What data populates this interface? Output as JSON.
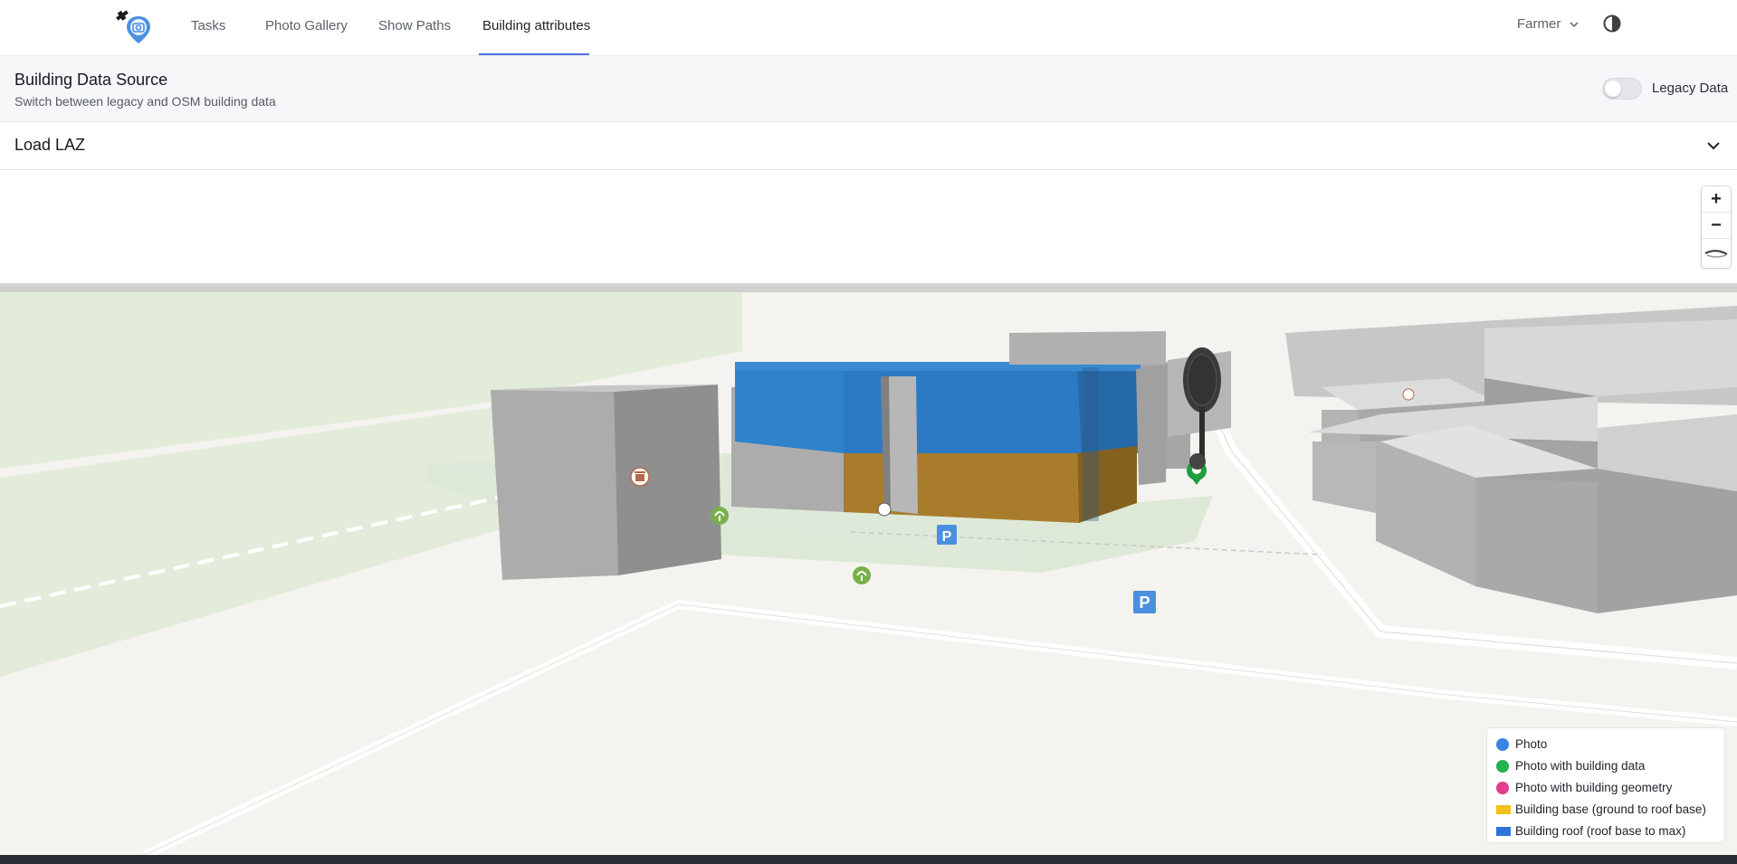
{
  "nav": {
    "tabs": [
      {
        "label": "Tasks"
      },
      {
        "label": "Photo Gallery"
      },
      {
        "label": "Show Paths"
      },
      {
        "label": "Building attributes",
        "active": true
      }
    ],
    "user": "Farmer",
    "accent": "#4a6fd6",
    "logo_icon": "camera-pin-satellite-icon",
    "theme_icon": "contrast-icon"
  },
  "source": {
    "title": "Building Data Source",
    "subtitle": "Switch between legacy and OSM building data",
    "toggle_label": "Legacy Data",
    "toggle_on": false
  },
  "laz": {
    "title": "Load LAZ",
    "expanded": false
  },
  "map": {
    "zoom_in": "+",
    "zoom_out": "−",
    "poi_icons": [
      "waste-basket-icon",
      "garden-icon",
      "parking-icon",
      "photo-marker-icon"
    ]
  },
  "legend": {
    "items": [
      {
        "label": "Photo",
        "color": "#3b82e6",
        "shape": "dot"
      },
      {
        "label": "Photo with building data",
        "color": "#22b14c",
        "shape": "dot"
      },
      {
        "label": "Photo with building geometry",
        "color": "#e23d8f",
        "shape": "dot"
      },
      {
        "label": "Building base (ground to roof base)",
        "color": "#f2c11a",
        "shape": "square"
      },
      {
        "label": "Building roof (roof base to max)",
        "color": "#2f73d9",
        "shape": "square"
      }
    ]
  },
  "colors": {
    "building_roof": "#2f82cc",
    "building_base": "#a97c2c",
    "building_gray": "#a9a9a9",
    "green_area": "#dde9d6",
    "ground": "#f5f3ef"
  }
}
